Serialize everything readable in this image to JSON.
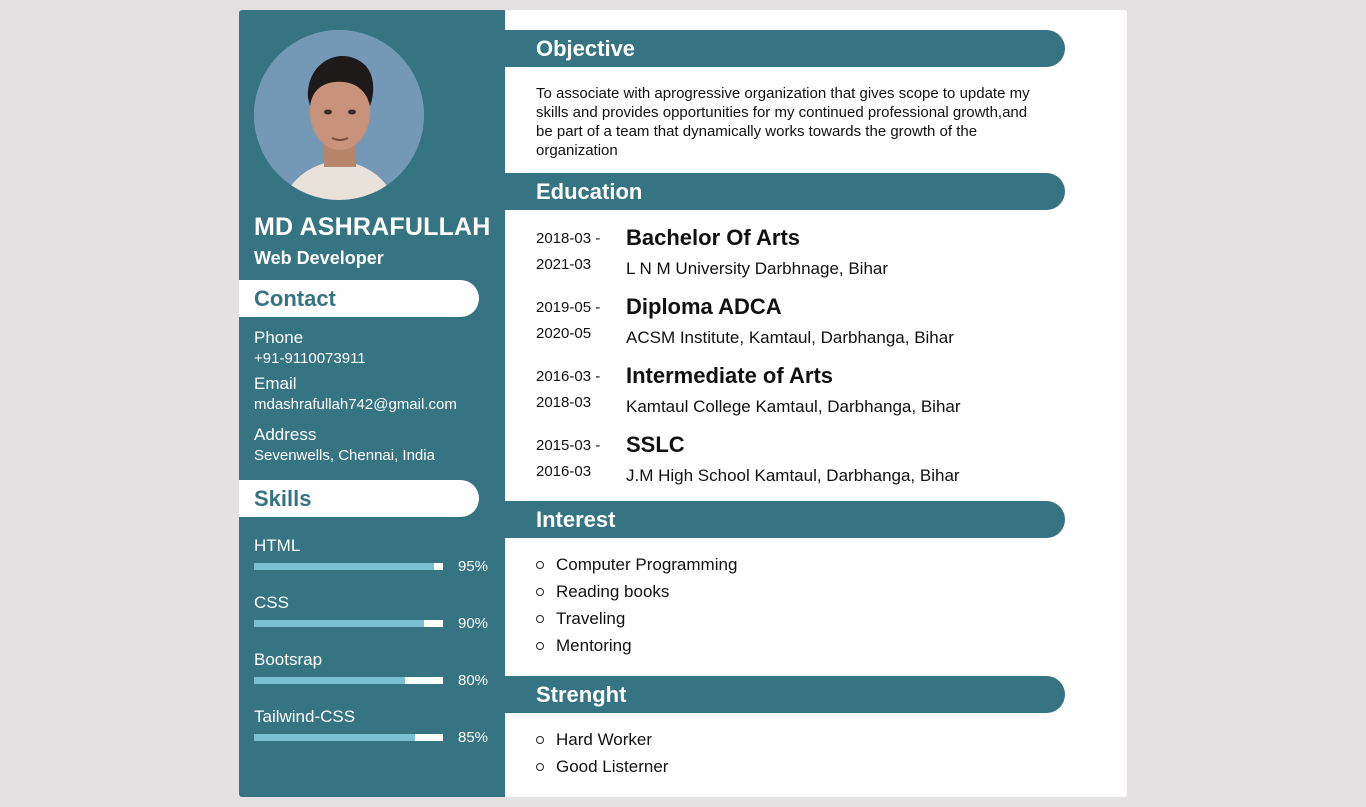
{
  "profile": {
    "name": "MD ASHRAFULLAH",
    "role": "Web Developer",
    "photo_icon": "profile-photo"
  },
  "contact": {
    "heading": "Contact",
    "phone_label": "Phone",
    "phone": "+91-9110073911",
    "email_label": "Email",
    "email": "mdashrafullah742@gmail.com",
    "address_label": "Address",
    "address": "Sevenwells, Chennai, India"
  },
  "skills": {
    "heading": "Skills",
    "items": [
      {
        "name": "HTML",
        "percent_label": "95%",
        "level": 0.95
      },
      {
        "name": "CSS",
        "percent_label": "90%",
        "level": 0.9
      },
      {
        "name": "Bootsrap",
        "percent_label": "80%",
        "level": 0.8
      },
      {
        "name": "Tailwind-CSS",
        "percent_label": "85%",
        "level": 0.85
      }
    ]
  },
  "objective": {
    "heading": "Objective",
    "text": "To associate with aprogressive organization that gives scope to update my skills and provides opportunities for my continued professional growth,and be part of a team that dynamically works towards the growth of the organization"
  },
  "education": {
    "heading": "Education",
    "items": [
      {
        "start": "2018-03 -",
        "end": "2021-03",
        "degree": "Bachelor Of Arts",
        "school": "L N M University Darbhnage, Bihar"
      },
      {
        "start": "2019-05 -",
        "end": "2020-05",
        "degree": "Diploma ADCA",
        "school": "ACSM Institute, Kamtaul, Darbhanga, Bihar"
      },
      {
        "start": "2016-03 -",
        "end": "2018-03",
        "degree": "Intermediate of Arts",
        "school": "Kamtaul College Kamtaul, Darbhanga, Bihar"
      },
      {
        "start": "2015-03 -",
        "end": "2016-03",
        "degree": "SSLC",
        "school": "J.M High School Kamtaul, Darbhanga, Bihar"
      }
    ]
  },
  "interest": {
    "heading": "Interest",
    "items": [
      "Computer Programming",
      "Reading books",
      "Traveling",
      "Mentoring"
    ]
  },
  "strength": {
    "heading": "Strenght",
    "items": [
      "Hard Worker",
      "Good Listerner"
    ]
  },
  "colors": {
    "primary": "#367383",
    "skill_fill": "#7bc0d2",
    "background": "#e3e1e2",
    "avatar_bg": "#7499b7"
  }
}
